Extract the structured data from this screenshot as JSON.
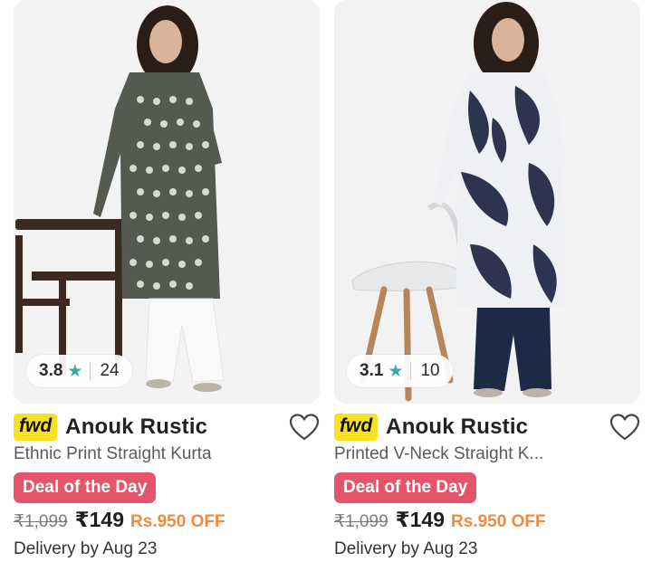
{
  "products": [
    {
      "rating": "3.8",
      "rating_count": "24",
      "badge": "fwd",
      "brand": "Anouk Rustic",
      "description": "Ethnic Print Straight Kurta",
      "deal_label": "Deal of the Day",
      "mrp": "₹1,099",
      "price": "₹149",
      "discount": "Rs.950 OFF",
      "delivery": "Delivery by Aug 23",
      "icons": {
        "star": "star-icon",
        "wishlist": "heart-icon"
      }
    },
    {
      "rating": "3.1",
      "rating_count": "10",
      "badge": "fwd",
      "brand": "Anouk Rustic",
      "description": "Printed V-Neck Straight K...",
      "deal_label": "Deal of the Day",
      "mrp": "₹1,099",
      "price": "₹149",
      "discount": "Rs.950 OFF",
      "delivery": "Delivery by Aug 23",
      "icons": {
        "star": "star-icon",
        "wishlist": "heart-icon"
      }
    }
  ],
  "colors": {
    "deal_badge": "#e5546b",
    "fwd_badge": "#f8e123",
    "discount_text": "#f08a3c",
    "rating_star": "#3ba7a0"
  }
}
